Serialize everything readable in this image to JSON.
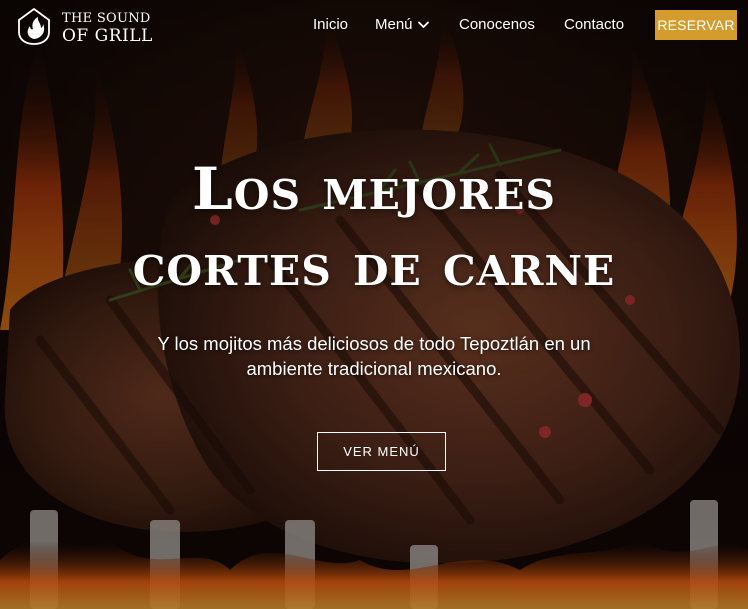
{
  "brand": {
    "line1": "THE SOUND",
    "line2": "OF GRILL",
    "logo_icon": "flame-house-icon"
  },
  "nav": {
    "items": [
      {
        "label": "Inicio"
      },
      {
        "label": "Menú",
        "icon": "chevron-down-icon"
      },
      {
        "label": "Conocenos"
      },
      {
        "label": "Contacto"
      }
    ],
    "cta_label": "RESERVAR"
  },
  "hero": {
    "title_line1": "Los mejores",
    "title_line2": "cortes de carne",
    "subtitle_line1": "Y los mojitos más deliciosos de todo Tepoztlán en un",
    "subtitle_line2": "ambiente tradicional mexicano.",
    "button_label": "VER MENÚ"
  },
  "colors": {
    "accent": "#d39c2c",
    "text": "#ffffff"
  }
}
